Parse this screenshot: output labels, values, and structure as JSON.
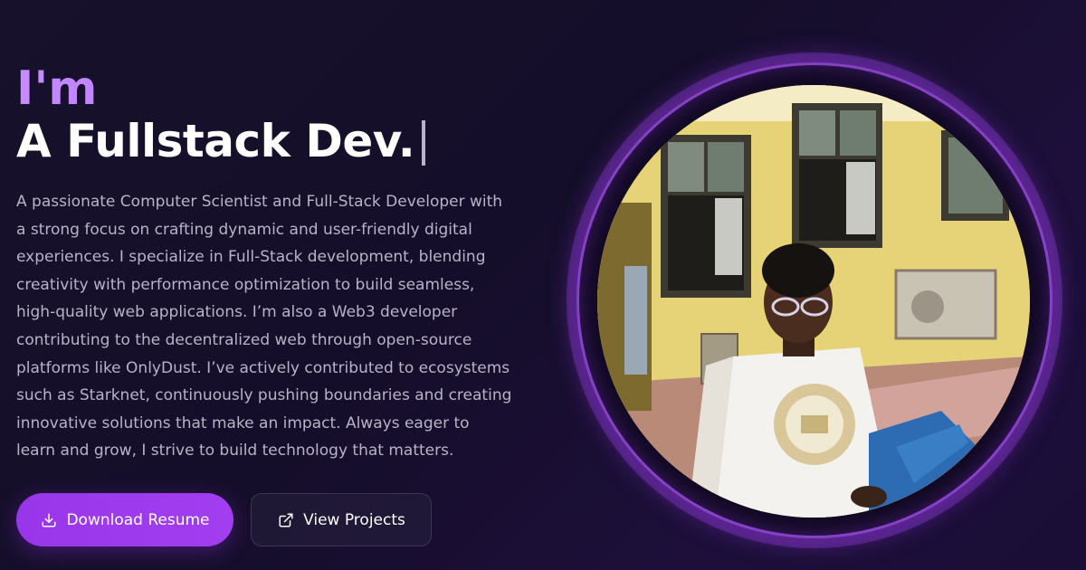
{
  "hero": {
    "greeting": "I'm",
    "role": "A Fullstack Dev.",
    "bio": "A passionate Computer Scientist and Full-Stack Developer with a strong focus on crafting dynamic and user-friendly digital experiences. I specialize in Full-Stack development, blending creativity with performance optimization to build seamless, high-quality web applications. I’m also a Web3 developer contributing to the decentralized web through open-source platforms like OnlyDust. I’ve actively contributed to ecosystems such as Starknet, continuously pushing boundaries and creating innovative solutions that make an impact. Always eager to learn and grow, I strive to build technology that matters."
  },
  "buttons": {
    "download_label": "Download Resume",
    "download_icon": "download-icon",
    "projects_label": "View Projects",
    "projects_icon": "external-link-icon"
  },
  "colors": {
    "accent": "#a23ef0",
    "greeting_gradient_start": "#c68cff",
    "background": "#150e2a",
    "body_text": "#b8b3c6"
  }
}
